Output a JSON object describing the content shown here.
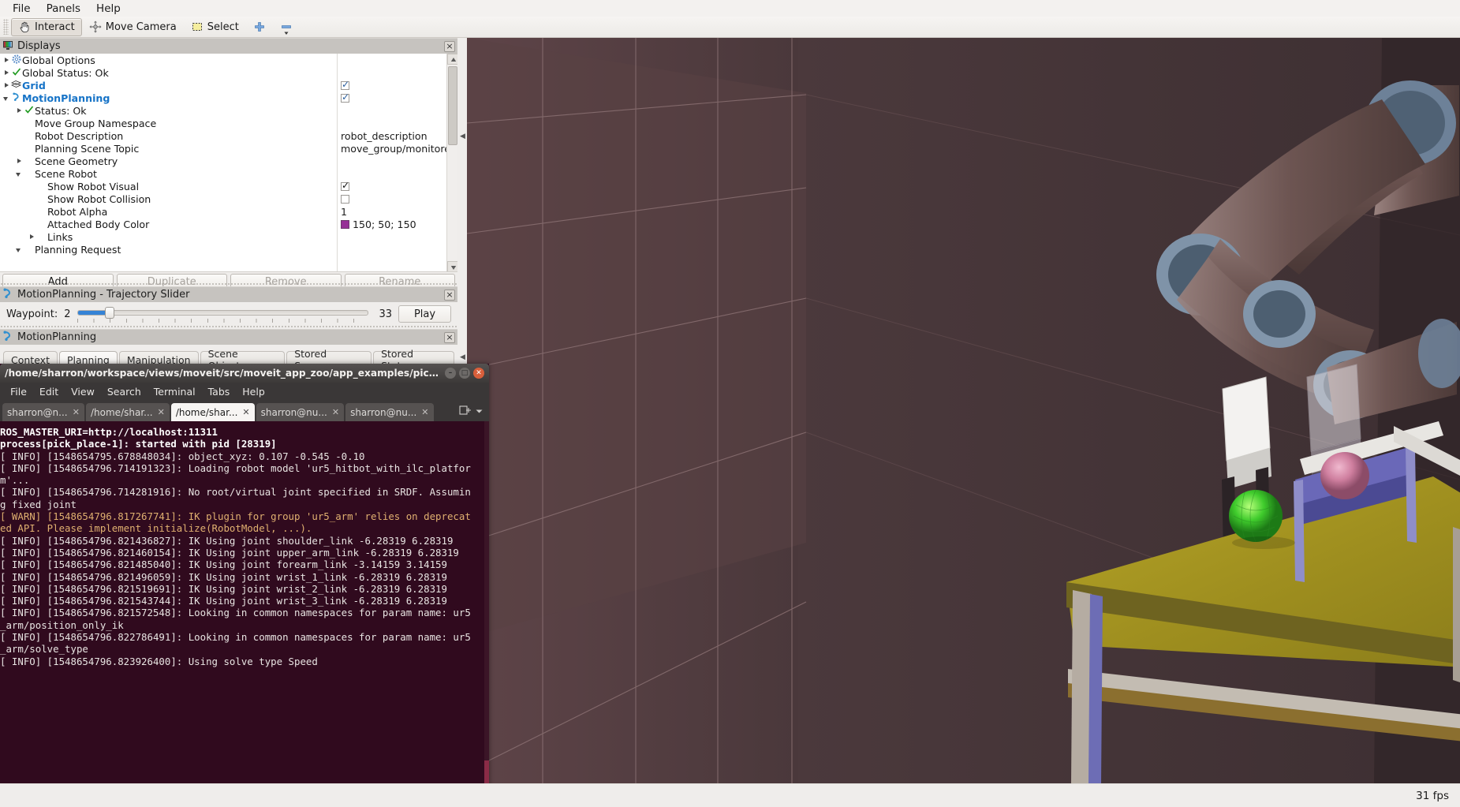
{
  "menubar": {
    "items": [
      "File",
      "Panels",
      "Help"
    ]
  },
  "toolbar": {
    "items": [
      {
        "label": "Interact",
        "icon": "hand-cursor-icon",
        "active": true
      },
      {
        "label": "Move Camera",
        "icon": "move-camera-icon",
        "active": false
      },
      {
        "label": "Select",
        "icon": "select-rect-icon",
        "active": false
      },
      {
        "label": "",
        "icon": "plus-icon",
        "active": false
      },
      {
        "label": "",
        "icon": "minus-icon",
        "active": false
      }
    ]
  },
  "displays_panel": {
    "title": "Displays",
    "title_icon": "displays-monitor-icon",
    "close_label": "×",
    "tree": [
      {
        "indent": 0,
        "arrow": "right",
        "icon": "gear-icon",
        "label": "Global Options",
        "style": "plain",
        "value_type": "none"
      },
      {
        "indent": 0,
        "arrow": "right",
        "icon": "check-icon",
        "label": "Global Status: Ok",
        "style": "plain",
        "value_type": "none"
      },
      {
        "indent": 0,
        "arrow": "right",
        "icon": "grid-icon",
        "label": "Grid",
        "style": "blue",
        "value_type": "checkbox",
        "checked": true
      },
      {
        "indent": 0,
        "arrow": "down",
        "icon": "motion-icon",
        "label": "MotionPlanning",
        "style": "blue",
        "value_type": "checkbox",
        "checked": true
      },
      {
        "indent": 1,
        "arrow": "right",
        "icon": "check-icon",
        "label": "Status: Ok",
        "style": "plain",
        "value_type": "none"
      },
      {
        "indent": 1,
        "arrow": "none",
        "icon": "none",
        "label": "Move Group Namespace",
        "style": "plain",
        "value_type": "none"
      },
      {
        "indent": 1,
        "arrow": "none",
        "icon": "none",
        "label": "Robot Description",
        "style": "plain",
        "value_type": "text",
        "value": "robot_description"
      },
      {
        "indent": 1,
        "arrow": "none",
        "icon": "none",
        "label": "Planning Scene Topic",
        "style": "plain",
        "value_type": "text",
        "value": "move_group/monitore."
      },
      {
        "indent": 1,
        "arrow": "right",
        "icon": "none",
        "label": "Scene Geometry",
        "style": "plain",
        "value_type": "none"
      },
      {
        "indent": 1,
        "arrow": "down",
        "icon": "none",
        "label": "Scene Robot",
        "style": "plain",
        "value_type": "none"
      },
      {
        "indent": 2,
        "arrow": "none",
        "icon": "none",
        "label": "Show Robot Visual",
        "style": "plain",
        "value_type": "checkbox-dark",
        "checked": true
      },
      {
        "indent": 2,
        "arrow": "none",
        "icon": "none",
        "label": "Show Robot Collision",
        "style": "plain",
        "value_type": "checkbox-dark",
        "checked": false
      },
      {
        "indent": 2,
        "arrow": "none",
        "icon": "none",
        "label": "Robot Alpha",
        "style": "plain",
        "value_type": "text",
        "value": "1"
      },
      {
        "indent": 2,
        "arrow": "none",
        "icon": "none",
        "label": "Attached Body Color",
        "style": "plain",
        "value_type": "color",
        "value": "150; 50; 150",
        "color": "#963096"
      },
      {
        "indent": 2,
        "arrow": "right",
        "icon": "none",
        "label": "Links",
        "style": "plain",
        "value_type": "none"
      },
      {
        "indent": 1,
        "arrow": "down",
        "icon": "none",
        "label": "Planning Request",
        "style": "plain",
        "value_type": "none"
      }
    ],
    "buttons": [
      {
        "label": "Add",
        "enabled": true
      },
      {
        "label": "Duplicate",
        "enabled": false
      },
      {
        "label": "Remove",
        "enabled": false
      },
      {
        "label": "Rename",
        "enabled": false
      }
    ]
  },
  "trajectory_panel": {
    "title": "MotionPlanning - Trajectory Slider",
    "title_icon": "motion-icon",
    "close_label": "×",
    "waypoint_label": "Waypoint:",
    "waypoint_value": "2",
    "max_value": "33",
    "play_label": "Play",
    "slider_percent": 6
  },
  "motionplanning_panel": {
    "title": "MotionPlanning",
    "title_icon": "motion-icon",
    "close_label": "×",
    "tabs": [
      {
        "label": "Context",
        "active": false
      },
      {
        "label": "Planning",
        "active": true
      },
      {
        "label": "Manipulation",
        "active": false
      },
      {
        "label": "Scene Objects",
        "active": false
      },
      {
        "label": "Stored Scenes",
        "active": false
      },
      {
        "label": "Stored States",
        "active": false
      }
    ]
  },
  "viewport": {
    "background_color": "#4d3a3c",
    "fps": "31 fps"
  },
  "terminal": {
    "title": "/home/sharron/workspace/views/moveit/src/moveit_app_zoo/app_examples/pick_place/lau...",
    "window_buttons": [
      {
        "name": "minimize",
        "glyph": "–"
      },
      {
        "name": "maximize",
        "glyph": "□"
      },
      {
        "name": "close",
        "glyph": "✕"
      }
    ],
    "menu": [
      "File",
      "Edit",
      "View",
      "Search",
      "Terminal",
      "Tabs",
      "Help"
    ],
    "tabs": [
      {
        "label": "sharron@n...",
        "active": false
      },
      {
        "label": "/home/shar...",
        "active": false
      },
      {
        "label": "/home/shar...",
        "active": true
      },
      {
        "label": "sharron@nu...",
        "active": false
      },
      {
        "label": "sharron@nu...",
        "active": false
      }
    ],
    "tab_add_icon": "new-tab-icon",
    "tab_menu_icon": "chevron-down-icon",
    "lines": [
      {
        "text": "ROS_MASTER_URI=http://localhost:11311",
        "style": "bold"
      },
      {
        "text": "",
        "style": "plain"
      },
      {
        "text": "process[pick_place-1]: started with pid [28319]",
        "style": "bold"
      },
      {
        "text": "[ INFO] [1548654795.678848034]: object_xyz: 0.107 -0.545 -0.10",
        "style": "plain"
      },
      {
        "text": "[ INFO] [1548654796.714191323]: Loading robot model 'ur5_hitbot_with_ilc_platfor",
        "style": "plain"
      },
      {
        "text": "m'...",
        "style": "plain"
      },
      {
        "text": "[ INFO] [1548654796.714281916]: No root/virtual joint specified in SRDF. Assumin",
        "style": "plain"
      },
      {
        "text": "g fixed joint",
        "style": "plain"
      },
      {
        "text": "[ WARN] [1548654796.817267741]: IK plugin for group 'ur5_arm' relies on deprecat",
        "style": "warn"
      },
      {
        "text": "ed API. Please implement initialize(RobotModel, ...).",
        "style": "warn"
      },
      {
        "text": "[ INFO] [1548654796.821436827]: IK Using joint shoulder_link -6.28319 6.28319",
        "style": "plain"
      },
      {
        "text": "[ INFO] [1548654796.821460154]: IK Using joint upper_arm_link -6.28319 6.28319",
        "style": "plain"
      },
      {
        "text": "[ INFO] [1548654796.821485040]: IK Using joint forearm_link -3.14159 3.14159",
        "style": "plain"
      },
      {
        "text": "[ INFO] [1548654796.821496059]: IK Using joint wrist_1_link -6.28319 6.28319",
        "style": "plain"
      },
      {
        "text": "[ INFO] [1548654796.821519691]: IK Using joint wrist_2_link -6.28319 6.28319",
        "style": "plain"
      },
      {
        "text": "[ INFO] [1548654796.821543744]: IK Using joint wrist_3_link -6.28319 6.28319",
        "style": "plain"
      },
      {
        "text": "[ INFO] [1548654796.821572548]: Looking in common namespaces for param name: ur5",
        "style": "plain"
      },
      {
        "text": "_arm/position_only_ik",
        "style": "plain"
      },
      {
        "text": "[ INFO] [1548654796.822786491]: Looking in common namespaces for param name: ur5",
        "style": "plain"
      },
      {
        "text": "_arm/solve_type",
        "style": "plain"
      },
      {
        "text": "[ INFO] [1548654796.823926400]: Using solve type Speed",
        "style": "plain"
      }
    ]
  }
}
